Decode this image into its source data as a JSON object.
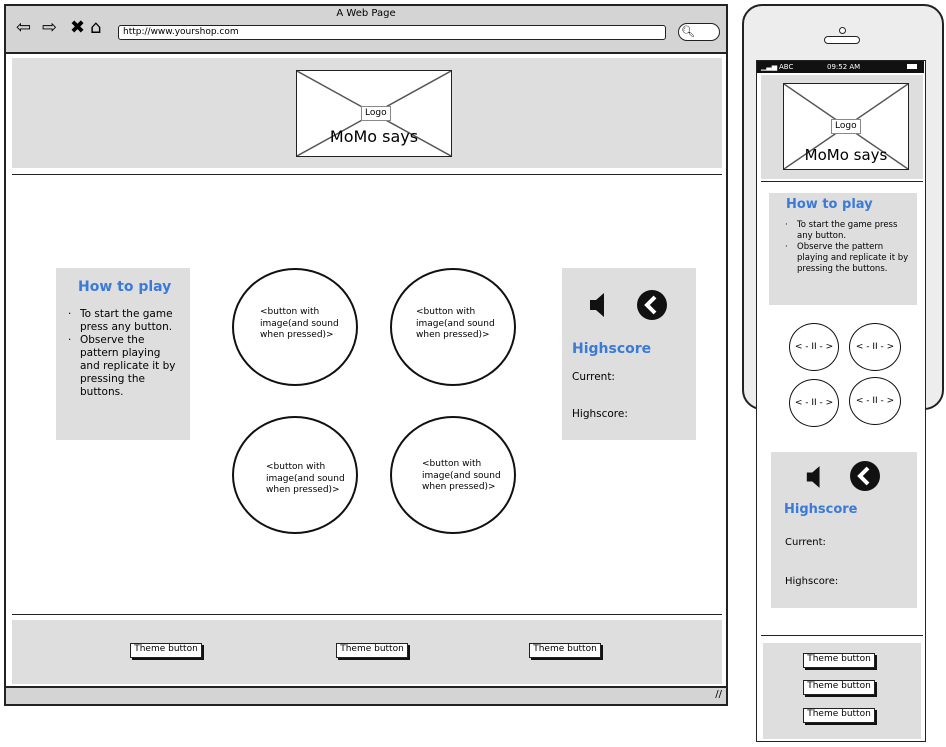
{
  "browser": {
    "title": "A Web Page",
    "url": "http://www.yourshop.com",
    "nav_icons": {
      "back": "back-arrow-icon",
      "forward": "forward-arrow-icon",
      "stop": "close-icon",
      "home": "home-icon",
      "search": "search-icon"
    }
  },
  "desktop": {
    "logo_tag": "Logo",
    "site_name": "MoMo says",
    "how_to_play": {
      "title": "How to play",
      "items": [
        "To start the game press any button.",
        "Observe the pattern playing and replicate it by pressing the buttons."
      ]
    },
    "game_buttons": [
      "<button with image(and sound when pressed)>",
      "<button with image(and sound when pressed)>",
      "<button with image(and sound when pressed)>",
      "<button with image(and sound when pressed)>"
    ],
    "score": {
      "title": "Highscore",
      "current_label": "Current:",
      "highscore_label": "Highscore:"
    },
    "theme_buttons": [
      "Theme button",
      "Theme button",
      "Theme button"
    ]
  },
  "phone": {
    "carrier": "ABC",
    "time": "09:52 AM",
    "logo_tag": "Logo",
    "site_name": "MoMo says",
    "how_to_play": {
      "title": "How to play",
      "items": [
        "To start the game press any button.",
        "Observe the pattern playing and replicate it by pressing the buttons."
      ]
    },
    "game_buttons": [
      "< - II - >",
      "< - II - >",
      "< - II - >",
      "< - II - >"
    ],
    "score": {
      "title": "Highscore",
      "current_label": "Current:",
      "highscore_label": "Highscore:"
    },
    "theme_buttons": [
      "Theme button",
      "Theme button",
      "Theme button"
    ]
  },
  "colors": {
    "accent": "#3a7ad8",
    "panel": "#dedede",
    "chrome": "#d4d4d4"
  }
}
